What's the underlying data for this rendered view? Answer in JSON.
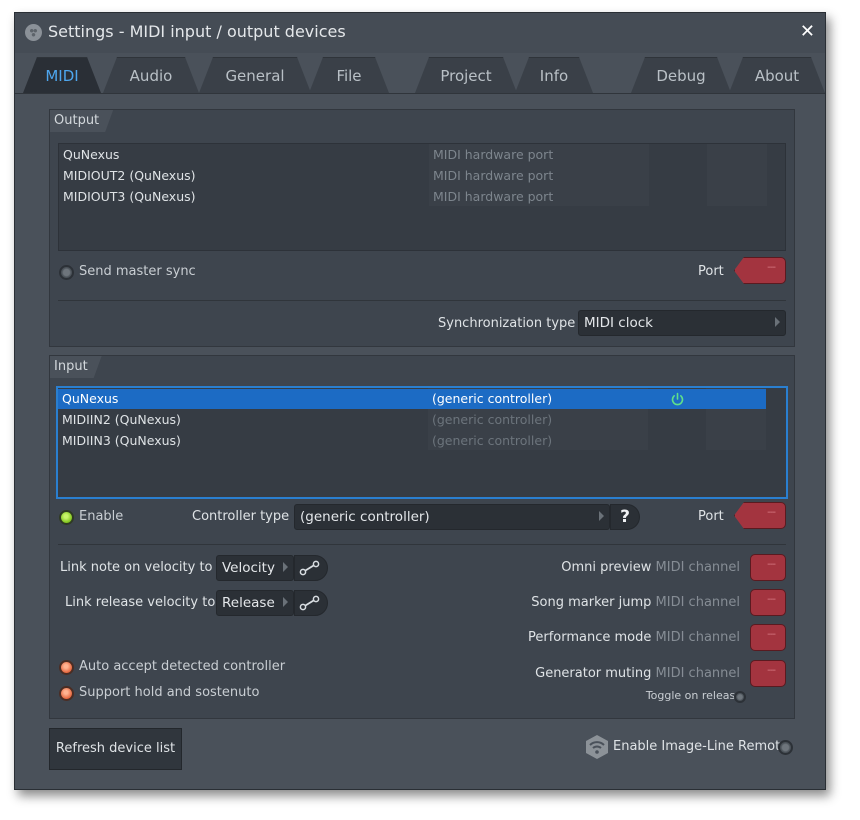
{
  "window": {
    "title": "Settings - MIDI input / output devices",
    "close_label": "✕"
  },
  "tabs": [
    {
      "label": "MIDI",
      "active": true
    },
    {
      "label": "Audio",
      "active": false
    },
    {
      "label": "General",
      "active": false
    },
    {
      "label": "File",
      "active": false
    },
    {
      "label": "Project",
      "active": false
    },
    {
      "label": "Info",
      "active": false
    },
    {
      "label": "Debug",
      "active": false
    },
    {
      "label": "About",
      "active": false
    }
  ],
  "output": {
    "section_label": "Output",
    "devices": [
      {
        "name": "QuNexus",
        "type": "MIDI hardware port"
      },
      {
        "name": "MIDIOUT2 (QuNexus)",
        "type": "MIDI hardware port"
      },
      {
        "name": "MIDIOUT3 (QuNexus)",
        "type": "MIDI hardware port"
      }
    ],
    "send_master_sync_label": "Send master sync",
    "send_master_sync_on": false,
    "port_label": "Port",
    "port_value": "---",
    "sync_type_label": "Synchronization type",
    "sync_type_value": "MIDI clock"
  },
  "input": {
    "section_label": "Input",
    "devices": [
      {
        "name": "QuNexus",
        "type": "(generic controller)",
        "selected": true,
        "enabled": true
      },
      {
        "name": "MIDIIN2 (QuNexus)",
        "type": "(generic controller)",
        "selected": false,
        "enabled": false
      },
      {
        "name": "MIDIIN3 (QuNexus)",
        "type": "(generic controller)",
        "selected": false,
        "enabled": false
      }
    ],
    "enable_label": "Enable",
    "enable_on": true,
    "controller_type_label": "Controller type",
    "controller_type_value": "(generic controller)",
    "help_label": "?",
    "port_label": "Port",
    "port_value": "---",
    "link_note_on_label": "Link note on velocity to",
    "link_note_on_value": "Velocity",
    "link_release_label": "Link release velocity to",
    "link_release_value": "Release",
    "channels": [
      {
        "label": "Omni preview",
        "suffix": "MIDI channel",
        "value": "---"
      },
      {
        "label": "Song marker jump",
        "suffix": "MIDI channel",
        "value": "---"
      },
      {
        "label": "Performance mode",
        "suffix": "MIDI channel",
        "value": "---"
      },
      {
        "label": "Generator muting",
        "suffix": "MIDI channel",
        "value": "---"
      }
    ],
    "toggle_on_release_label": "Toggle on release",
    "auto_accept_label": "Auto accept detected controller",
    "support_hold_label": "Support hold and sostenuto"
  },
  "footer": {
    "refresh_label": "Refresh device list",
    "remote_label": "Enable Image-Line Remote"
  },
  "colors": {
    "accent_blue": "#1c6bc4",
    "active_tab_text": "#4ea6ee",
    "port_red": "#a3343f",
    "enabled_green": "#7fc31c",
    "option_orange": "#e5663e"
  }
}
